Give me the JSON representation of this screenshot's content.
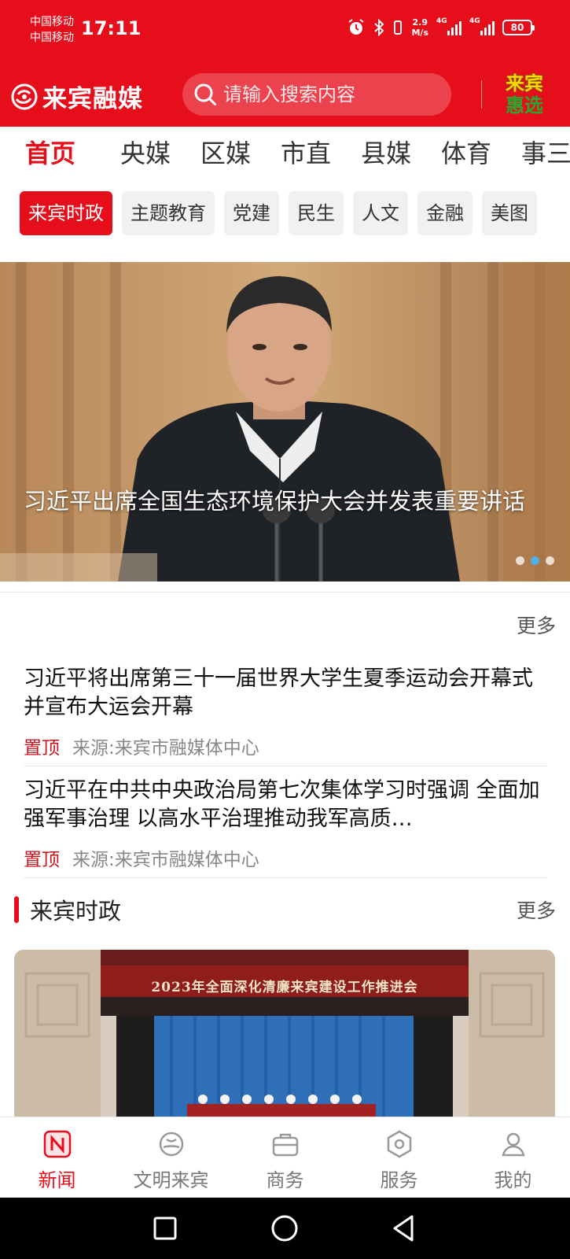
{
  "status_bar": {
    "carrier_1": "中国移动",
    "carrier_2": "中国移动",
    "time": "17:11",
    "net_speed_value": "2.9",
    "net_speed_unit": "M/s",
    "signal_1_type": "4G",
    "signal_2_type": "4G",
    "battery": "80",
    "icons": [
      "alarm-icon",
      "bluetooth-icon",
      "vibrate-icon",
      "signal-icon",
      "battery-icon"
    ]
  },
  "header": {
    "app_name": "来宾融媒",
    "search_placeholder": "请输入搜索内容",
    "promo_line1": "来宾",
    "promo_line2": "惠选",
    "brand_color": "#e60e1b"
  },
  "channels": [
    "首页",
    "央媒",
    "区媒",
    "市直",
    "县媒",
    "体育",
    "事三"
  ],
  "active_channel": 0,
  "subtabs": [
    "来宾时政",
    "主题教育",
    "党建",
    "民生",
    "人文",
    "金融",
    "美图"
  ],
  "active_subtab": 0,
  "banner": {
    "title": "习近平出席全国生态环境保护大会并发表重要讲话",
    "slide_count": 3,
    "active_slide": 1
  },
  "top_list": {
    "more_label": "更多",
    "items": [
      {
        "title": "习近平将出席第三十一届世界大学生夏季运动会开幕式并宣布大运会开幕",
        "tag": "置顶",
        "source": "来源:来宾市融媒体中心"
      },
      {
        "title": "习近平在中共中央政治局第七次集体学习时强调 全面加强军事治理 以高水平治理推动我军高质…",
        "tag": "置顶",
        "source": "来源:来宾市融媒体中心"
      }
    ]
  },
  "section": {
    "title": "来宾时政",
    "more_label": "更多",
    "photo_caption": "2023年全面深化清廉来宾建设工作推进会"
  },
  "bottom_nav": [
    {
      "label": "新闻",
      "icon": "news-icon"
    },
    {
      "label": "文明来宾",
      "icon": "civility-icon"
    },
    {
      "label": "商务",
      "icon": "briefcase-icon"
    },
    {
      "label": "服务",
      "icon": "service-icon"
    },
    {
      "label": "我的",
      "icon": "profile-icon"
    }
  ],
  "active_nav": 0,
  "system_nav": [
    "recent-apps-icon",
    "home-icon",
    "back-icon"
  ]
}
